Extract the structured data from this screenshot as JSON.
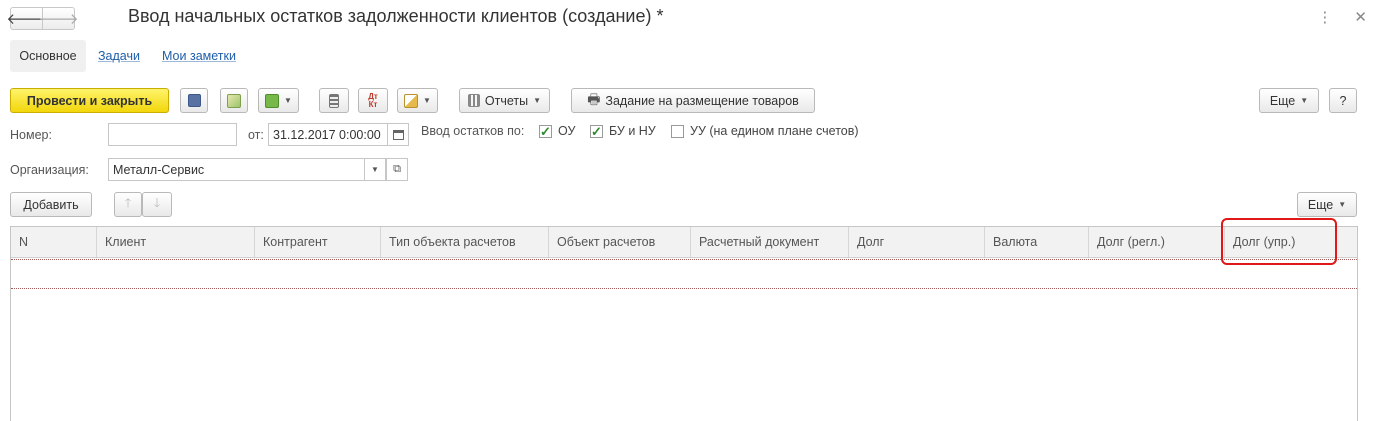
{
  "window": {
    "title": "Ввод начальных остатков задолженности клиентов (создание) *"
  },
  "tabs": [
    {
      "label": "Основное"
    },
    {
      "label": "Задачи"
    },
    {
      "label": "Мои заметки"
    }
  ],
  "toolbar": {
    "post_and_close": "Провести и закрыть",
    "reports": "Отчеты",
    "placement_task": "Задание на размещение товаров",
    "more": "Еще",
    "help": "?"
  },
  "form": {
    "number_label": "Номер:",
    "number_value": "",
    "date_label": "от:",
    "date_value": "31.12.2017  0:00:00",
    "balance_input_label": "Ввод остатков по:",
    "checkboxes": [
      {
        "label": "ОУ",
        "checked": true
      },
      {
        "label": "БУ и НУ",
        "checked": true
      },
      {
        "label": "УУ (на едином плане счетов)",
        "checked": false
      }
    ],
    "organization_label": "Организация:",
    "organization_value": "Металл-Сервис"
  },
  "table_toolbar": {
    "add": "Добавить",
    "more": "Еще"
  },
  "table": {
    "columns": [
      "N",
      "Клиент",
      "Контрагент",
      "Тип объекта расчетов",
      "Объект расчетов",
      "Расчетный документ",
      "Долг",
      "Валюта",
      "Долг (регл.)",
      "Долг (упр.)"
    ],
    "rows": []
  },
  "colors": {
    "primary_button": "#f2d60c",
    "link": "#1f5ea8",
    "check": "#2f8a2f",
    "highlight": "#e01818"
  }
}
